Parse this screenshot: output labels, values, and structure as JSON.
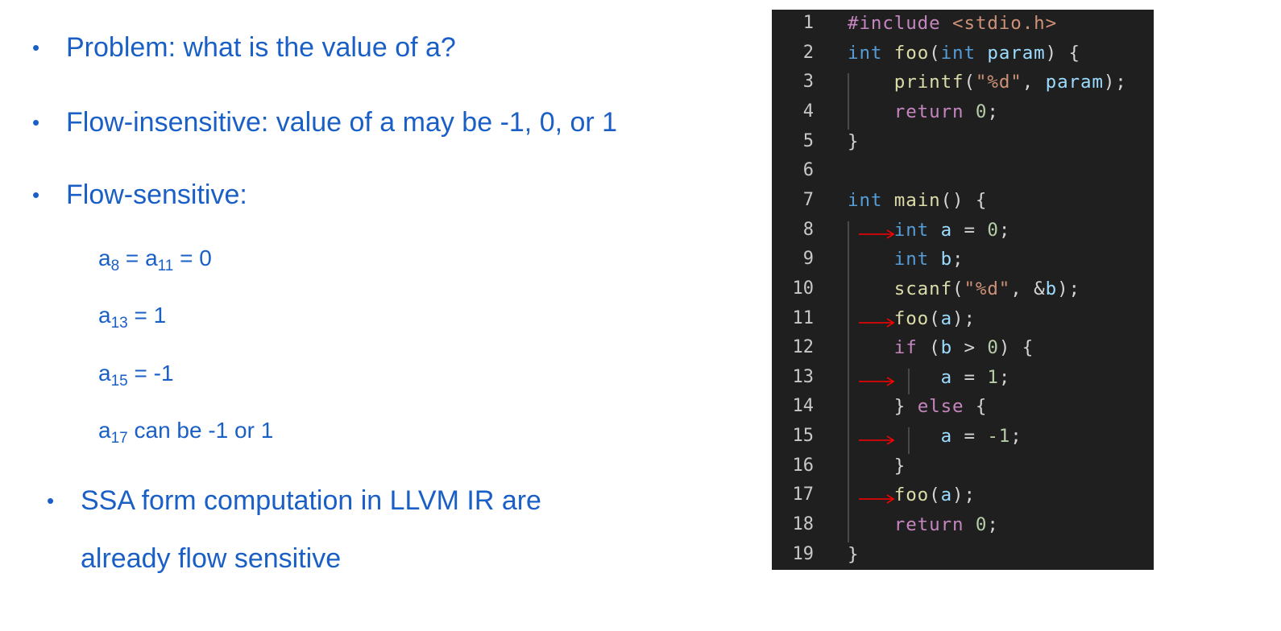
{
  "bullets": {
    "problem": "Problem: what is the value of a?",
    "flow_insensitive": "Flow-insensitive: value of a may be -1, 0, or 1",
    "flow_sensitive": "Flow-sensitive:",
    "ssa_line1": "SSA form computation in LLVM IR are",
    "ssa_line2": "already flow sensitive"
  },
  "sub_items": [
    {
      "parts": [
        "a",
        "8",
        " = a",
        "11",
        " = 0"
      ]
    },
    {
      "parts": [
        "a",
        "13",
        " = 1"
      ]
    },
    {
      "parts": [
        "a",
        "15",
        " = -1"
      ]
    },
    {
      "parts": [
        "a",
        "17",
        " can be -1 or 1"
      ]
    }
  ],
  "bullet_glyph": "•",
  "colors": {
    "text": "#1a5fc6",
    "code_bg": "#1f1f1f",
    "arrow": "#ff0000"
  },
  "code": {
    "arrow_lines": [
      8,
      11,
      13,
      15,
      17
    ],
    "lines": [
      {
        "n": "1",
        "tokens": [
          [
            "#include ",
            "ctl"
          ],
          [
            "<stdio.h>",
            "str"
          ]
        ]
      },
      {
        "n": "2",
        "tokens": [
          [
            "int ",
            "kw"
          ],
          [
            "foo",
            "fn"
          ],
          [
            "(",
            "pun"
          ],
          [
            "int ",
            "kw"
          ],
          [
            "param",
            "var"
          ],
          [
            ") {",
            "pun"
          ]
        ]
      },
      {
        "n": "3",
        "tokens": [
          [
            "    printf",
            "fn"
          ],
          [
            "(",
            "pun"
          ],
          [
            "\"%d\"",
            "str"
          ],
          [
            ", ",
            "pun"
          ],
          [
            "param",
            "var"
          ],
          [
            ");",
            "pun"
          ]
        ]
      },
      {
        "n": "4",
        "tokens": [
          [
            "    return ",
            "ctl"
          ],
          [
            "0",
            "num"
          ],
          [
            ";",
            "pun"
          ]
        ]
      },
      {
        "n": "5",
        "tokens": [
          [
            "}",
            "pun"
          ]
        ]
      },
      {
        "n": "6",
        "tokens": []
      },
      {
        "n": "7",
        "tokens": [
          [
            "int ",
            "kw"
          ],
          [
            "main",
            "fn"
          ],
          [
            "() {",
            "pun"
          ]
        ]
      },
      {
        "n": "8",
        "tokens": [
          [
            "    int ",
            "kw"
          ],
          [
            "a",
            "var"
          ],
          [
            " = ",
            "pun"
          ],
          [
            "0",
            "num"
          ],
          [
            ";",
            "pun"
          ]
        ]
      },
      {
        "n": "9",
        "tokens": [
          [
            "    int ",
            "kw"
          ],
          [
            "b",
            "var"
          ],
          [
            ";",
            "pun"
          ]
        ]
      },
      {
        "n": "10",
        "tokens": [
          [
            "    scanf",
            "fn"
          ],
          [
            "(",
            "pun"
          ],
          [
            "\"%d\"",
            "str"
          ],
          [
            ", &",
            "pun"
          ],
          [
            "b",
            "var"
          ],
          [
            ");",
            "pun"
          ]
        ]
      },
      {
        "n": "11",
        "tokens": [
          [
            "    foo",
            "fn"
          ],
          [
            "(",
            "pun"
          ],
          [
            "a",
            "var"
          ],
          [
            ");",
            "pun"
          ]
        ]
      },
      {
        "n": "12",
        "tokens": [
          [
            "    if ",
            "ctl"
          ],
          [
            "(",
            "pun"
          ],
          [
            "b",
            "var"
          ],
          [
            " > ",
            "pun"
          ],
          [
            "0",
            "num"
          ],
          [
            ") {",
            "pun"
          ]
        ]
      },
      {
        "n": "13",
        "tokens": [
          [
            "        a",
            "var"
          ],
          [
            " = ",
            "pun"
          ],
          [
            "1",
            "num"
          ],
          [
            ";",
            "pun"
          ]
        ]
      },
      {
        "n": "14",
        "tokens": [
          [
            "    } ",
            "pun"
          ],
          [
            "else ",
            "ctl"
          ],
          [
            "{",
            "pun"
          ]
        ]
      },
      {
        "n": "15",
        "tokens": [
          [
            "        a",
            "var"
          ],
          [
            " = ",
            "pun"
          ],
          [
            "-1",
            "num"
          ],
          [
            ";",
            "pun"
          ]
        ]
      },
      {
        "n": "16",
        "tokens": [
          [
            "    }",
            "pun"
          ]
        ]
      },
      {
        "n": "17",
        "tokens": [
          [
            "    foo",
            "fn"
          ],
          [
            "(",
            "pun"
          ],
          [
            "a",
            "var"
          ],
          [
            ");",
            "pun"
          ]
        ]
      },
      {
        "n": "18",
        "tokens": [
          [
            "    return ",
            "ctl"
          ],
          [
            "0",
            "num"
          ],
          [
            ";",
            "pun"
          ]
        ]
      },
      {
        "n": "19",
        "tokens": [
          [
            "}",
            "pun"
          ]
        ]
      }
    ]
  }
}
